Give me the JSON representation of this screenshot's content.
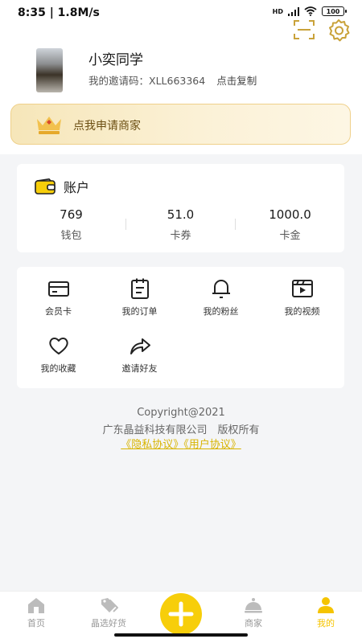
{
  "status_bar": {
    "time": "8:35 | 1.8M/s",
    "network": "HD",
    "battery": "100"
  },
  "header": {
    "scan_icon": "scan-icon",
    "settings_icon": "gear-icon"
  },
  "profile": {
    "name": "小奕同学",
    "invite_label": "我的邀请码：XLL663364",
    "copy_label": "点击复制"
  },
  "merchant_banner": {
    "label": "点我申请商家",
    "icon": "crown-icon"
  },
  "account": {
    "title": "账户",
    "icon": "wallet-icon",
    "stats": [
      {
        "value": "769",
        "label": "钱包"
      },
      {
        "value": "51.0",
        "label": "卡券"
      },
      {
        "value": "1000.0",
        "label": "卡金"
      }
    ]
  },
  "menu": {
    "items": [
      {
        "label": "会员卡",
        "icon": "card-icon"
      },
      {
        "label": "我的订单",
        "icon": "clipboard-icon"
      },
      {
        "label": "我的粉丝",
        "icon": "bell-icon"
      },
      {
        "label": "我的视频",
        "icon": "video-icon"
      },
      {
        "label": "我的收藏",
        "icon": "heart-icon"
      },
      {
        "label": "邀请好友",
        "icon": "share-icon"
      }
    ]
  },
  "footer": {
    "copyright": "Copyright@2021",
    "company": "广东晶益科技有限公司　版权所有",
    "privacy_link": "《隐私协议》",
    "user_link": "《用户协议》"
  },
  "tabbar": {
    "tabs": [
      {
        "label": "首页",
        "icon": "home-icon"
      },
      {
        "label": "晶选好货",
        "icon": "tags-icon"
      },
      {
        "label": "",
        "icon": "plus-icon"
      },
      {
        "label": "商家",
        "icon": "cloche-icon"
      },
      {
        "label": "我的",
        "icon": "person-icon"
      }
    ],
    "active_tab": "我的"
  },
  "colors": {
    "accent": "#f7ce0a",
    "link": "#d8b400",
    "banner_text": "#6b4e12"
  }
}
